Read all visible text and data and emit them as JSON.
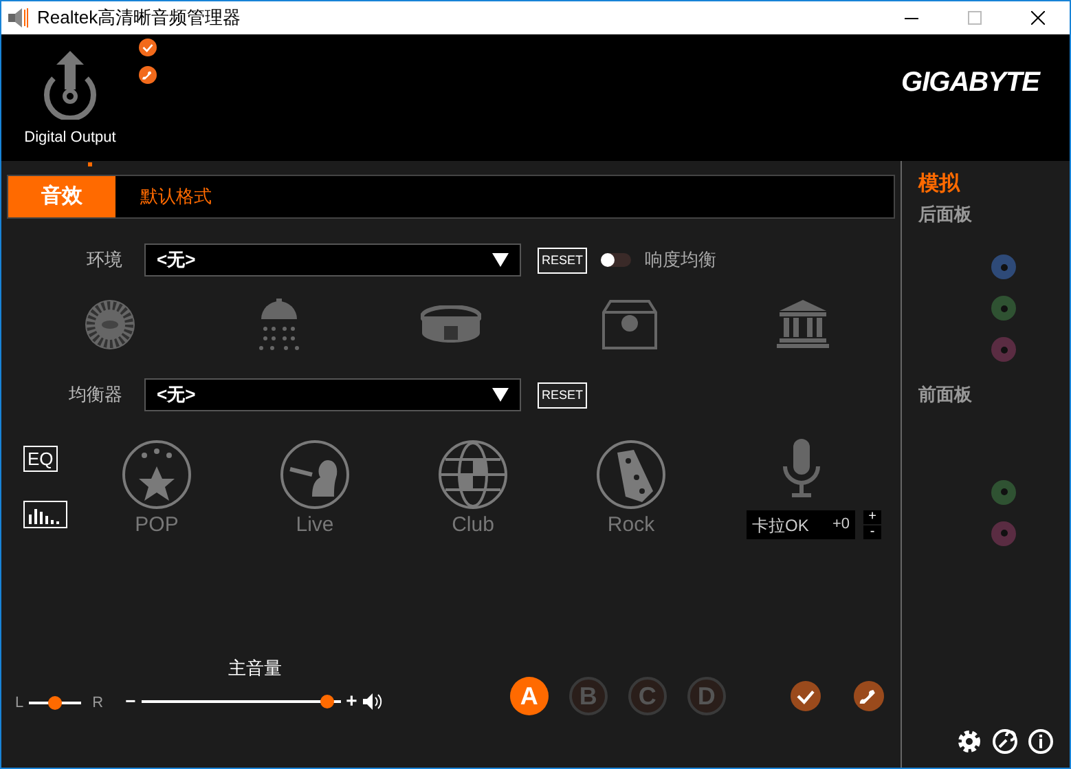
{
  "window": {
    "title": "Realtek高清晰音频管理器"
  },
  "device": {
    "label": "Digital Output",
    "selected": true
  },
  "brand": "GIGABYTE",
  "tabs": [
    {
      "label": "音效",
      "selected": true
    },
    {
      "label": "默认格式",
      "selected": false
    }
  ],
  "environment": {
    "label": "环境",
    "value": "<无>",
    "reset": "RESET",
    "toggle": {
      "label": "响度均衡",
      "on": false
    }
  },
  "equalizer": {
    "label": "均衡器",
    "value": "<无>",
    "reset": "RESET",
    "eq_button": "EQ"
  },
  "eq_presets": [
    "POP",
    "Live",
    "Club",
    "Rock"
  ],
  "karaoke": {
    "label": "卡拉OK",
    "value": "+0",
    "plus": "+",
    "minus": "-"
  },
  "balance": {
    "left": "L",
    "right": "R",
    "level": 0.5
  },
  "master_volume": {
    "label": "主音量",
    "minus": "−",
    "plus": "+",
    "level": 0.93
  },
  "profiles": [
    {
      "label": "A",
      "selected": true
    },
    {
      "label": "B",
      "selected": false
    },
    {
      "label": "C",
      "selected": false
    },
    {
      "label": "D",
      "selected": false
    }
  ],
  "side_panel": {
    "title": "模拟",
    "rear_label": "后面板",
    "rear_jacks": [
      {
        "color": "#2e4a78"
      },
      {
        "color": "#2f5232"
      },
      {
        "color": "#5a2c42"
      }
    ],
    "front_label": "前面板",
    "front_jacks": [
      {
        "color": "#2f5232"
      },
      {
        "color": "#5a2c42"
      }
    ]
  }
}
